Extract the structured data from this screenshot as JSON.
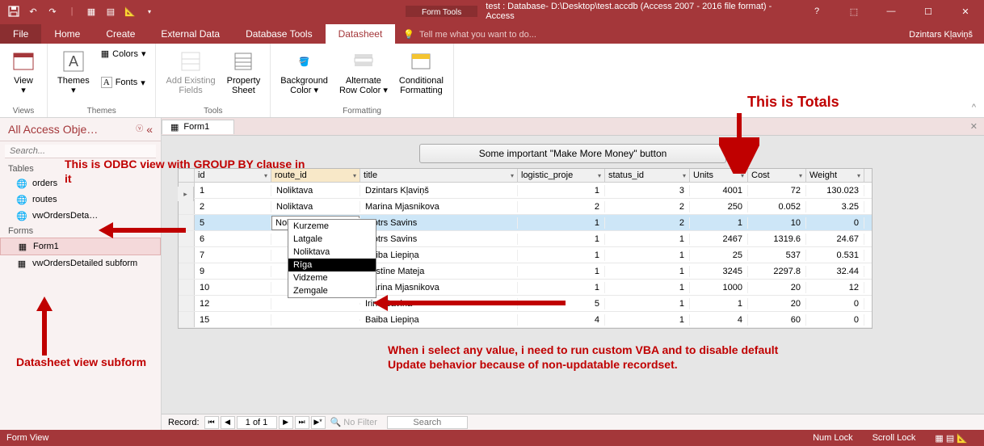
{
  "titlebar": {
    "form_tools": "Form Tools",
    "title": "test : Database- D:\\Desktop\\test.accdb (Access 2007 - 2016 file format) - Access"
  },
  "ribbon_tabs": {
    "file": "File",
    "home": "Home",
    "create": "Create",
    "external": "External Data",
    "dbtools": "Database Tools",
    "datasheet": "Datasheet",
    "tellme": "Tell me what you want to do...",
    "user": "Dzintars Kļaviņš"
  },
  "ribbon": {
    "views": {
      "view": "View",
      "group": "Views"
    },
    "themes": {
      "themes": "Themes",
      "colors": "Colors",
      "fonts": "Fonts",
      "group": "Themes"
    },
    "tools": {
      "add_fields": "Add Existing\nFields",
      "property": "Property\nSheet",
      "group": "Tools"
    },
    "formatting": {
      "bg": "Background\nColor",
      "row": "Alternate\nRow Color",
      "cond": "Conditional\nFormatting",
      "group": "Formatting"
    }
  },
  "navpane": {
    "header": "All Access Obje…",
    "search_placeholder": "Search...",
    "tables": "Tables",
    "forms": "Forms",
    "items_tables": [
      "orders",
      "routes",
      "vwOrdersDeta…"
    ],
    "items_forms": [
      "Form1",
      "vwOrdersDetailed subform"
    ]
  },
  "doc": {
    "tab": "Form1"
  },
  "form": {
    "big_button": "Some important \"Make More Money\" button"
  },
  "datasheet": {
    "cols": [
      "id",
      "route_id",
      "title",
      "logistic_proje",
      "status_id",
      "Units",
      "Cost",
      "Weight"
    ],
    "selected_combo_value": "Noliktava",
    "dropdown": [
      "Kurzeme",
      "Latgale",
      "Noliktava",
      "Rīga",
      "Vidzeme",
      "Zemgale"
    ],
    "rows": [
      {
        "id": "1",
        "route": "Noliktava",
        "title": "Dzintars Kļaviņš",
        "log": "1",
        "status": "3",
        "units": "4001",
        "cost": "72",
        "weight": "130.023"
      },
      {
        "id": "2",
        "route": "Noliktava",
        "title": "Marina Mjasnikova",
        "log": "2",
        "status": "2",
        "units": "250",
        "cost": "0.052",
        "weight": "3.25"
      },
      {
        "id": "5",
        "route": "",
        "title": "Pjotrs Savins",
        "log": "1",
        "status": "2",
        "units": "1",
        "cost": "10",
        "weight": "0"
      },
      {
        "id": "6",
        "route": "",
        "title": "Pjotrs Savins",
        "log": "1",
        "status": "1",
        "units": "2467",
        "cost": "1319.6",
        "weight": "24.67"
      },
      {
        "id": "7",
        "route": "",
        "title": "Baiba Liepiņa",
        "log": "1",
        "status": "1",
        "units": "25",
        "cost": "537",
        "weight": "0.531"
      },
      {
        "id": "9",
        "route": "",
        "title": "Kristīne Mateja",
        "log": "1",
        "status": "1",
        "units": "3245",
        "cost": "2297.8",
        "weight": "32.44"
      },
      {
        "id": "10",
        "route": "",
        "title": "Marina Mjasnikova",
        "log": "1",
        "status": "1",
        "units": "1000",
        "cost": "20",
        "weight": "12"
      },
      {
        "id": "12",
        "route": "",
        "title": "Irina Savina",
        "log": "5",
        "status": "1",
        "units": "1",
        "cost": "20",
        "weight": "0"
      },
      {
        "id": "15",
        "route": "",
        "title": "Baiba Liepiņa",
        "log": "4",
        "status": "1",
        "units": "4",
        "cost": "60",
        "weight": "0"
      }
    ]
  },
  "recnav": {
    "label": "Record:",
    "pos": "1 of 1",
    "nofilter": "No Filter",
    "search": "Search"
  },
  "statusbar": {
    "left": "Form View",
    "num": "Num Lock",
    "scroll": "Scroll Lock"
  },
  "annotations": {
    "totals": "This is Totals",
    "odbc": "This is ODBC view with GROUP BY clause in it",
    "subform": "Datasheet view subform",
    "vba": "When i select any value, i need to run custom VBA and to disable default Update behavior because of non-updatable recordset."
  }
}
